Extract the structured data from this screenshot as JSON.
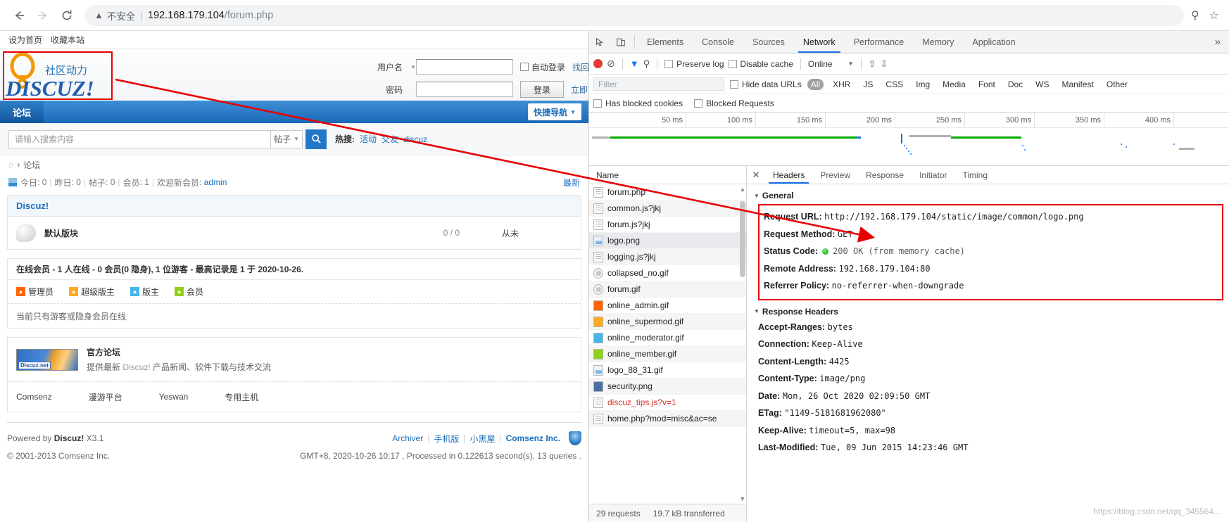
{
  "browser": {
    "back_icon": "back-arrow-icon",
    "forward_icon": "forward-arrow-icon",
    "reload_icon": "reload-icon",
    "warning_icon": "warning-triangle-icon",
    "insecure_label": "不安全",
    "url_host": "192.168.179.104",
    "url_path": "/forum.php",
    "zoom_icon": "zoom-search-icon",
    "star_icon": "bookmark-star-icon",
    "bookmarks": [
      "设为首页",
      "收藏本站"
    ]
  },
  "page": {
    "logo": {
      "tagline": "社区动力",
      "wordmark": "DISCUZ!"
    },
    "login": {
      "username_label": "用户名",
      "password_label": "密码",
      "username_value": "",
      "password_value": "",
      "autologin_label": "自动登录",
      "findpw_label": "找回",
      "login_button": "登录",
      "register_label": "立即"
    },
    "nav": {
      "items": [
        "论坛"
      ],
      "quick_nav": "快捷导航"
    },
    "search": {
      "placeholder": "请输入搜索内容",
      "scope": "帖子",
      "hot_label": "热搜:",
      "hot_items": [
        "活动",
        "交友",
        "discuz"
      ]
    },
    "breadcrumb": {
      "home_icon": "home-icon",
      "sep": "›",
      "current": "论坛"
    },
    "stats": {
      "today_label": "今日",
      "today_value": "0",
      "yesterday_label": "昨日",
      "yesterday_value": "0",
      "posts_label": "帖子",
      "posts_value": "0",
      "members_label": "会员",
      "members_value": "1",
      "welcome_label": "欢迎新会员",
      "welcome_value": "admin",
      "newest_link": "最新"
    },
    "forum_panel": {
      "title": "Discuz!",
      "row_name": "默认版块",
      "row_count": "0 / 0",
      "row_last": "从未"
    },
    "online": {
      "summary": "在线会员 - 1 人在线 - 0 会员(0 隐身), 1 位游客 - 最高记录是 1 于 2020-10-26.",
      "legend": [
        {
          "label": "管理员",
          "color": "#ff6600"
        },
        {
          "label": "超级版主",
          "color": "#ffaa22"
        },
        {
          "label": "版主",
          "color": "#44b6e8"
        },
        {
          "label": "会员",
          "color": "#8fd119"
        }
      ],
      "note": "当前只有游客或隐身会员在线"
    },
    "partner": {
      "badge_text": "Discuz.net",
      "title": "官方论坛",
      "desc_pre": "提供最新 ",
      "desc_brand": "Discuz!",
      "desc_post": " 产品新闻、软件下载与技术交流",
      "links": [
        "Comsenz",
        "漫游平台",
        "Yeswan",
        "专用主机"
      ]
    },
    "footer": {
      "powered_pre": "Powered by ",
      "powered_brand": "Discuz!",
      "powered_ver": " X3.1",
      "copyright": "© 2001-2013 Comsenz Inc.",
      "links": [
        "Archiver",
        "手机版",
        "小黑屋",
        "Comsenz Inc."
      ],
      "gmt_line": "GMT+8, 2020-10-26 10:17 , Processed in 0.122613 second(s), 13 queries .",
      "shield_icon": "security-shield-icon"
    }
  },
  "devtools": {
    "inspect_icon": "inspect-element-icon",
    "device_icon": "device-toolbar-icon",
    "tabs": [
      "Elements",
      "Console",
      "Sources",
      "Network",
      "Performance",
      "Memory",
      "Application"
    ],
    "active_tab": "Network",
    "more_tabs_icon": "chevron-double-right-icon",
    "controls": {
      "record_icon": "record-stop-icon",
      "clear_icon": "clear-network-icon",
      "filter_icon": "filter-funnel-icon",
      "search_icon": "search-icon",
      "preserve_log": "Preserve log",
      "disable_cache": "Disable cache",
      "throttling": "Online",
      "throttling_caret": "chevron-down-icon",
      "import_icon": "import-har-icon",
      "export_icon": "export-har-icon"
    },
    "filter": {
      "placeholder": "Filter",
      "hide_data_urls": "Hide data URLs",
      "types": [
        "All",
        "XHR",
        "JS",
        "CSS",
        "Img",
        "Media",
        "Font",
        "Doc",
        "WS",
        "Manifest",
        "Other"
      ],
      "active_type": "All",
      "has_blocked_cookies": "Has blocked cookies",
      "blocked_requests": "Blocked Requests"
    },
    "overview": {
      "ticks": [
        "50 ms",
        "100 ms",
        "150 ms",
        "200 ms",
        "250 ms",
        "300 ms",
        "350 ms",
        "400 ms"
      ]
    },
    "list": {
      "header": "Name",
      "rows": [
        {
          "name": "forum.php",
          "icon": "document-icon"
        },
        {
          "name": "common.js?jkj",
          "icon": "document-icon"
        },
        {
          "name": "forum.js?jkj",
          "icon": "document-icon"
        },
        {
          "name": "logo.png",
          "icon": "image-icon"
        },
        {
          "name": "logging.js?jkj",
          "icon": "document-icon"
        },
        {
          "name": "collapsed_no.gif",
          "icon": "gif-icon"
        },
        {
          "name": "forum.gif",
          "icon": "gif-icon"
        },
        {
          "name": "online_admin.gif",
          "icon": "avatar-orange-icon"
        },
        {
          "name": "online_supermod.gif",
          "icon": "avatar-yellow-icon"
        },
        {
          "name": "online_moderator.gif",
          "icon": "avatar-blue-icon"
        },
        {
          "name": "online_member.gif",
          "icon": "avatar-green-icon"
        },
        {
          "name": "logo_88_31.gif",
          "icon": "image-icon"
        },
        {
          "name": "security.png",
          "icon": "shield-icon"
        },
        {
          "name": "discuz_tips.js?v=1",
          "icon": "document-icon",
          "error": true
        },
        {
          "name": "home.php?mod=misc&ac=se",
          "icon": "document-icon"
        }
      ],
      "selected": "logo.png",
      "footer": {
        "requests": "29 requests",
        "transferred": "19.7 kB transferred"
      }
    },
    "detail": {
      "close_icon": "close-icon",
      "tabs": [
        "Headers",
        "Preview",
        "Response",
        "Initiator",
        "Timing"
      ],
      "active_tab": "Headers",
      "general_title": "General",
      "general": [
        {
          "key": "Request URL:",
          "value": "http://192.168.179.104/static/image/common/logo.png"
        },
        {
          "key": "Request Method:",
          "value": "GET"
        },
        {
          "key": "Status Code:",
          "value": "200 OK (from memory cache)",
          "dot": true
        },
        {
          "key": "Remote Address:",
          "value": "192.168.179.104:80"
        },
        {
          "key": "Referrer Policy:",
          "value": "no-referrer-when-downgrade"
        }
      ],
      "response_title": "Response Headers",
      "response": [
        {
          "key": "Accept-Ranges:",
          "value": "bytes"
        },
        {
          "key": "Connection:",
          "value": "Keep-Alive"
        },
        {
          "key": "Content-Length:",
          "value": "4425"
        },
        {
          "key": "Content-Type:",
          "value": "image/png"
        },
        {
          "key": "Date:",
          "value": "Mon, 26 Oct 2020 02:09:50 GMT"
        },
        {
          "key": "ETag:",
          "value": "\"1149-5181681962080\""
        },
        {
          "key": "Keep-Alive:",
          "value": "timeout=5, max=98"
        },
        {
          "key": "Last-Modified:",
          "value": "Tue, 09 Jun 2015 14:23:46 GMT"
        }
      ]
    }
  },
  "annotations": {
    "highlight_color": "#e60000",
    "watermark": "https://blog.csdn.net/qq_345564..."
  }
}
